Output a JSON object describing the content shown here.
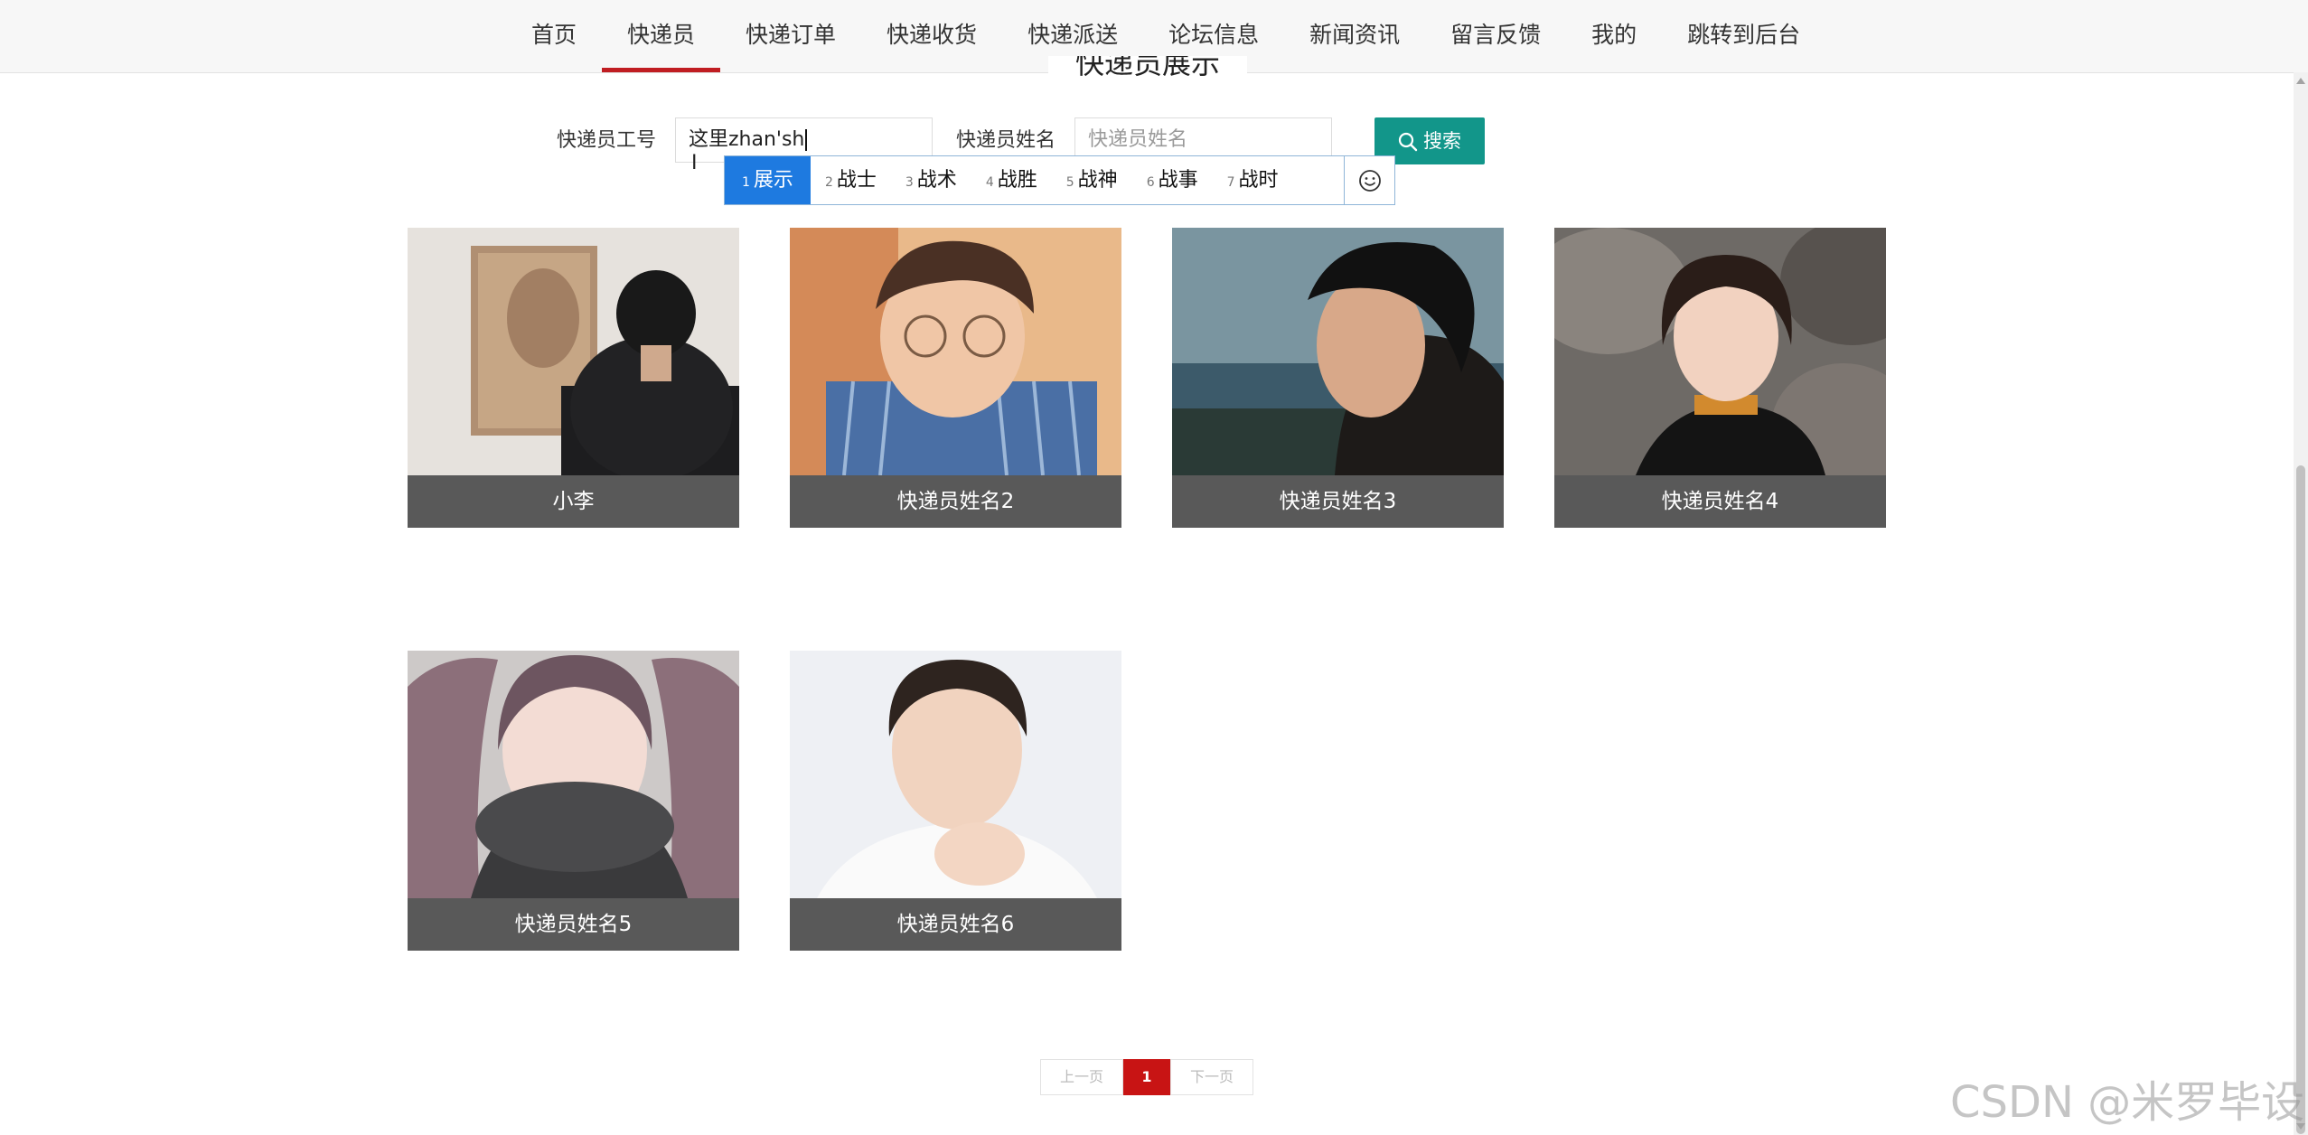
{
  "nav": {
    "items": [
      {
        "label": "首页"
      },
      {
        "label": "快递员"
      },
      {
        "label": "快递订单"
      },
      {
        "label": "快递收货"
      },
      {
        "label": "快递派送"
      },
      {
        "label": "论坛信息"
      },
      {
        "label": "新闻资讯"
      },
      {
        "label": "留言反馈"
      },
      {
        "label": "我的"
      },
      {
        "label": "跳转到后台"
      }
    ],
    "active": "快递员",
    "accent_color": "#c01d22"
  },
  "page": {
    "title": "快递员展示"
  },
  "search": {
    "id_label": "快递员工号",
    "id_value": "这里zhan'sh",
    "name_label": "快递员姓名",
    "name_placeholder": "快递员姓名",
    "button_label": "搜索",
    "button_color": "#12968a"
  },
  "ime": {
    "candidates": [
      {
        "num": "1",
        "text": "展示"
      },
      {
        "num": "2",
        "text": "战士"
      },
      {
        "num": "3",
        "text": "战术"
      },
      {
        "num": "4",
        "text": "战胜"
      },
      {
        "num": "5",
        "text": "战神"
      },
      {
        "num": "6",
        "text": "战事"
      },
      {
        "num": "7",
        "text": "战时"
      }
    ],
    "selected": "1",
    "emoji_icon": "smiley-icon"
  },
  "couriers": [
    {
      "name": "小李"
    },
    {
      "name": "快递员姓名2"
    },
    {
      "name": "快递员姓名3"
    },
    {
      "name": "快递员姓名4"
    },
    {
      "name": "快递员姓名5"
    },
    {
      "name": "快递员姓名6"
    }
  ],
  "pagination": {
    "prev": "上一页",
    "current": "1",
    "next": "下一页",
    "current_color": "#c81414"
  },
  "watermark": "CSDN @米罗毕设"
}
